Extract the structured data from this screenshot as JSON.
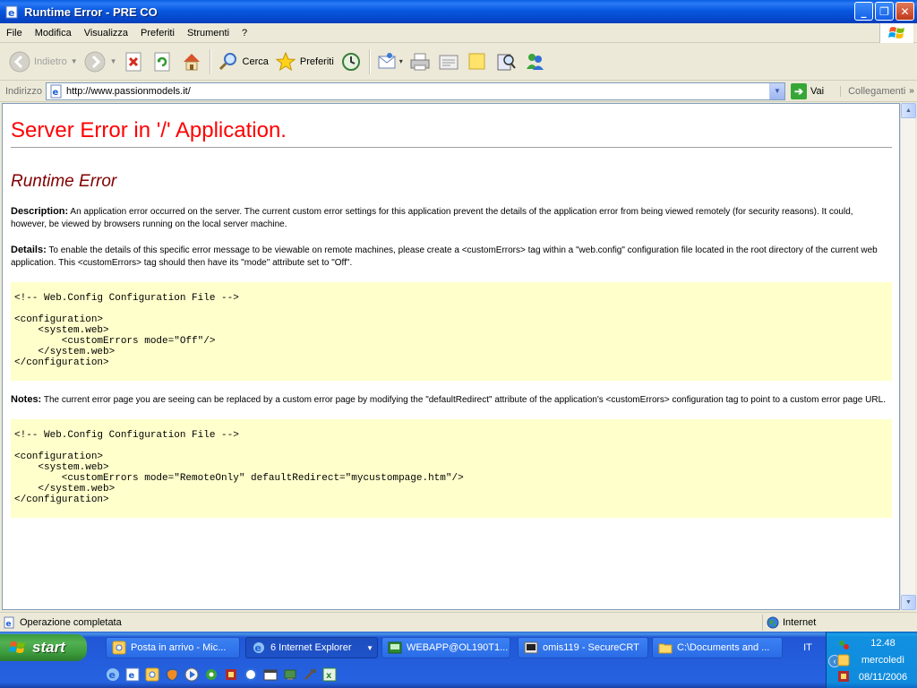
{
  "window": {
    "title": "Runtime Error - PRE CO"
  },
  "menu": [
    "File",
    "Modifica",
    "Visualizza",
    "Preferiti",
    "Strumenti",
    "?"
  ],
  "toolbar": {
    "back": "Indietro",
    "search": "Cerca",
    "favorites": "Preferiti"
  },
  "address": {
    "label": "Indirizzo",
    "url": "http://www.passionmodels.it/",
    "go": "Vai",
    "links": "Collegamenti"
  },
  "page": {
    "title": "Server Error in '/' Application.",
    "subtitle": "Runtime Error",
    "description_label": "Description:",
    "description": "An application error occurred on the server. The current custom error settings for this application prevent the details of the application error from being viewed remotely (for security reasons). It could, however, be viewed by browsers running on the local server machine.",
    "details_label": "Details:",
    "details": "To enable the details of this specific error message to be viewable on remote machines, please create a <customErrors> tag within a \"web.config\" configuration file located in the root directory of the current web application. This <customErrors> tag should then have its \"mode\" attribute set to \"Off\".",
    "code1": "<!-- Web.Config Configuration File -->\n\n<configuration>\n    <system.web>\n        <customErrors mode=\"Off\"/>\n    </system.web>\n</configuration>",
    "notes_label": "Notes:",
    "notes": "The current error page you are seeing can be replaced by a custom error page by modifying the \"defaultRedirect\" attribute of the application's <customErrors> configuration tag to point to a custom error page URL.",
    "code2": "<!-- Web.Config Configuration File -->\n\n<configuration>\n    <system.web>\n        <customErrors mode=\"RemoteOnly\" defaultRedirect=\"mycustompage.htm\"/>\n    </system.web>\n</configuration>"
  },
  "status": {
    "text": "Operazione completata",
    "zone": "Internet"
  },
  "taskbar": {
    "start": "start",
    "tasks": [
      "Posta in arrivo - Mic...",
      "6 Internet Explorer",
      "WEBAPP@OL190T1...",
      "omis119 - SecureCRT",
      "C:\\Documents and ..."
    ],
    "lang": "IT",
    "time": "12.48",
    "day": "mercoledì",
    "date": "08/11/2006"
  },
  "colors": {
    "error_title": "#ff0000",
    "subtitle": "#800000",
    "code_bg": "#ffffcc"
  }
}
